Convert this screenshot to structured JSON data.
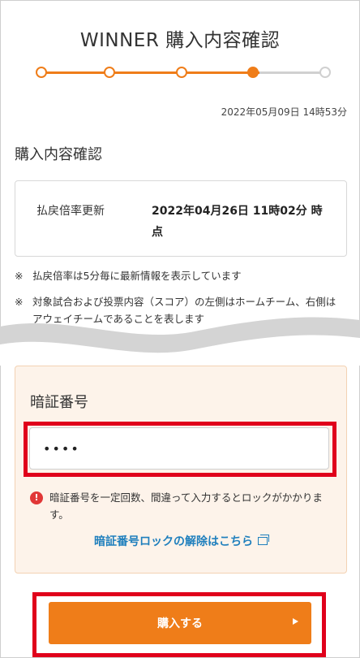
{
  "header": {
    "title": "WINNER 購入内容確認"
  },
  "steps": {
    "total": 5,
    "current": 4,
    "accent": "#ef7d19",
    "inactive": "#d0d0d0"
  },
  "timestamp": "2022年05月09日 14時53分",
  "section": {
    "heading": "購入内容確認"
  },
  "odds": {
    "label": "払戻倍率更新",
    "value": "2022年04月26日 11時02分 時点"
  },
  "notes": [
    {
      "mark": "※",
      "text": "払戻倍率は5分毎に最新情報を表示しています"
    },
    {
      "mark": "※",
      "text": "対象試合および投票内容（スコア）の左側はホームチーム、右側はアウェイチームであることを表します"
    }
  ],
  "pin": {
    "title": "暗証番号",
    "value": "••••",
    "warning": "暗証番号を一定回数、間違って入力するとロックがかかります。",
    "unlock_link": "暗証番号ロックの解除はこちら",
    "highlight_color": "#e0001b"
  },
  "buy": {
    "label": "購入する",
    "color": "#ef7d19"
  },
  "icons": {
    "warning": "exclamation-circle-icon",
    "external": "external-window-icon",
    "arrow": "play-arrow-icon"
  }
}
